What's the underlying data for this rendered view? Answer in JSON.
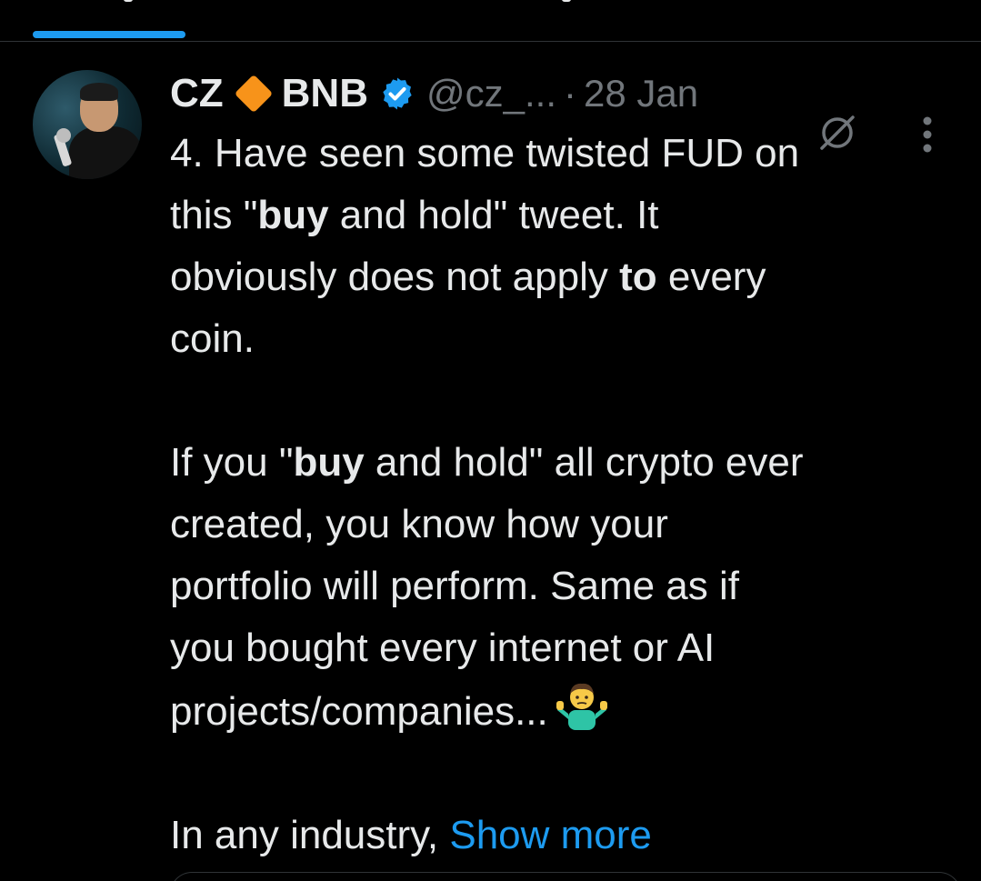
{
  "tweet": {
    "display_name_1": "CZ",
    "display_name_2": "BNB",
    "handle": "@cz_...",
    "separator": "·",
    "timestamp": "28 Jan",
    "lines": {
      "l1": "4. Have seen some twisted FUD on",
      "l2a": "this \"",
      "l2b": "buy",
      "l2c": " and hold\" tweet. It",
      "l3a": "obviously does not apply ",
      "l3b": "to",
      "l3c": " every",
      "l4": "coin.",
      "p2_1a": "If you \"",
      "p2_1b": "buy",
      "p2_1c": " and hold\" all crypto ever",
      "p2_2": "created, you know how your",
      "p2_3": "portfolio will perform. Same as if",
      "p2_4": "you bought every internet or AI",
      "p2_5": "projects/companies...",
      "p3a": "In any industry, ",
      "show_more": "Show more"
    }
  },
  "colors": {
    "background": "#000000",
    "text": "#e7e9ea",
    "muted": "#71767b",
    "accent": "#1d9bf0",
    "divider": "#2f3336",
    "diamond": "#f7931a"
  },
  "icons": {
    "verified": "verified-badge-icon",
    "grok": "grok-icon",
    "more": "more-options-icon",
    "emoji": "person-shrugging-emoji",
    "diamond": "orange-diamond-icon"
  }
}
